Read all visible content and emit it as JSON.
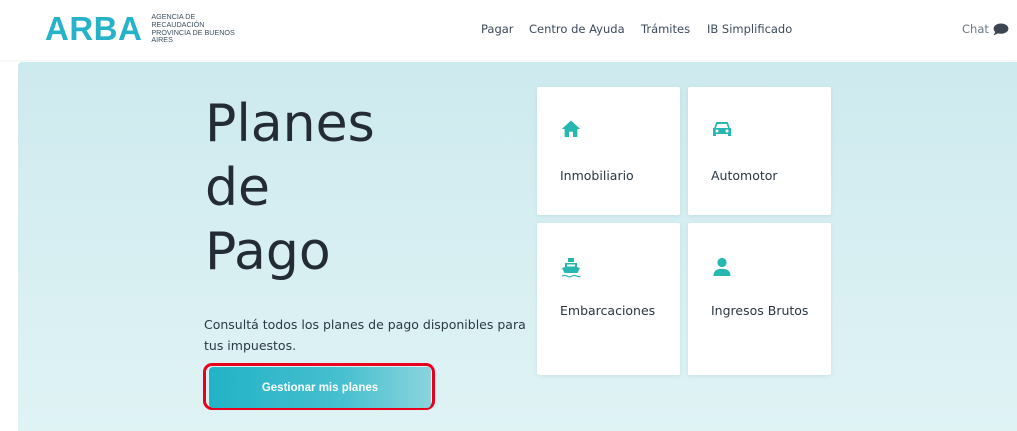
{
  "brand": {
    "logo_text": "ARBA",
    "agency_line1": "AGENCIA DE",
    "agency_line2": "RECAUDACIÓN",
    "agency_line3": "PROVINCIA DE BUENOS",
    "agency_line4": "AIRES",
    "accent_color": "#26b3c9"
  },
  "nav": {
    "items": [
      {
        "label": "Pagar"
      },
      {
        "label": "Centro de Ayuda"
      },
      {
        "label": "Trámites"
      },
      {
        "label": "IB Simplificado"
      }
    ],
    "chat_label": "Chat",
    "chat_icon": "speech-bubble-icon"
  },
  "hero": {
    "title_line1": "Planes",
    "title_line2": "de",
    "title_line3": "Pago",
    "description": "Consultá todos los planes de pago disponibles para tus impuestos.",
    "cta_label": "Gestionar mis planes",
    "cta_highlight_color": "#e8001d"
  },
  "cards": [
    {
      "label": "Inmobiliario",
      "icon": "house-icon"
    },
    {
      "label": "Automotor",
      "icon": "car-icon"
    },
    {
      "label": "Embarcaciones",
      "icon": "ship-icon"
    },
    {
      "label": "Ingresos Brutos",
      "icon": "person-icon"
    }
  ]
}
